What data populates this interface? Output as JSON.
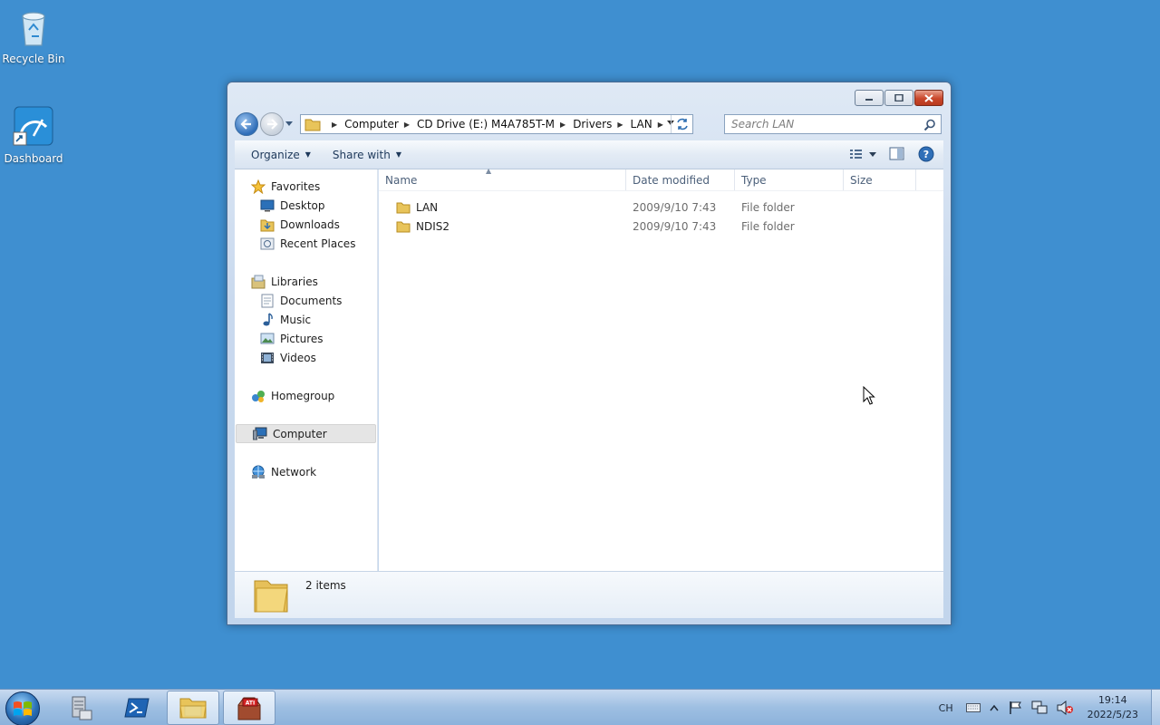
{
  "desktop": {
    "icons": [
      {
        "label": "Recycle Bin",
        "icon": "recycle-bin-icon"
      },
      {
        "label": "Dashboard",
        "icon": "dashboard-icon"
      }
    ]
  },
  "window": {
    "address": {
      "crumbs": [
        "Computer",
        "CD Drive (E:) M4A785T-M",
        "Drivers",
        "LAN"
      ]
    },
    "search": {
      "placeholder": "Search LAN"
    },
    "commands": {
      "organize": "Organize",
      "share": "Share with"
    },
    "nav": {
      "favorites": {
        "label": "Favorites",
        "items": [
          "Desktop",
          "Downloads",
          "Recent Places"
        ]
      },
      "libraries": {
        "label": "Libraries",
        "items": [
          "Documents",
          "Music",
          "Pictures",
          "Videos"
        ]
      },
      "homegroup": "Homegroup",
      "computer": "Computer",
      "network": "Network"
    },
    "columns": {
      "name": "Name",
      "date": "Date modified",
      "type": "Type",
      "size": "Size"
    },
    "files": [
      {
        "name": "LAN",
        "date": "2009/9/10 7:43",
        "type": "File folder",
        "size": ""
      },
      {
        "name": "NDIS2",
        "date": "2009/9/10 7:43",
        "type": "File folder",
        "size": ""
      }
    ],
    "status": {
      "count": "2 items"
    }
  },
  "taskbar": {
    "lang": "CH",
    "time": "19:14",
    "date": "2022/5/23"
  },
  "colors": {
    "desktop": "#3f8fd0",
    "folder": "#e8c45a"
  }
}
